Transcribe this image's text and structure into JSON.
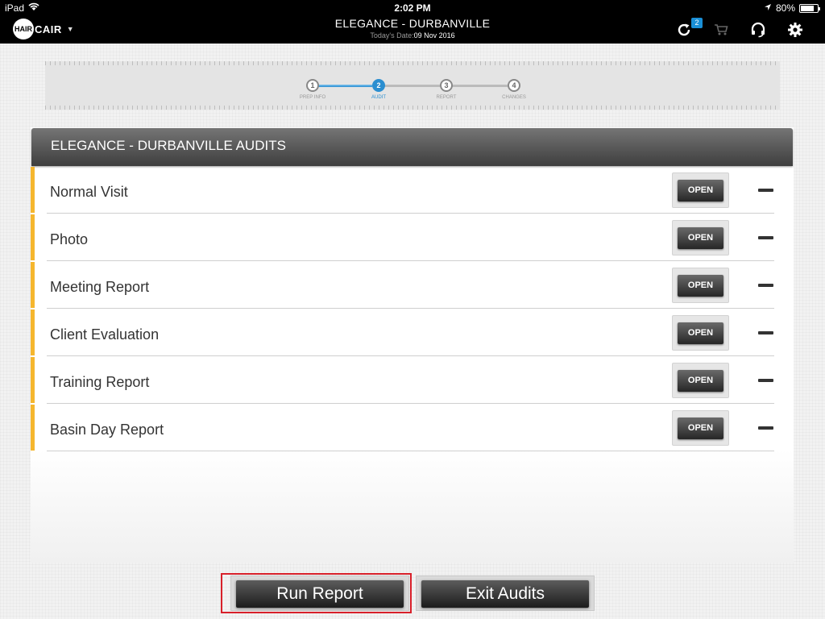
{
  "status_bar": {
    "device": "iPad",
    "time": "2:02 PM",
    "battery": "80%",
    "battery_level": 0.8
  },
  "header": {
    "logo_left": "HAIR",
    "logo_right": "CAIR",
    "store_title": "ELEGANCE - DURBANVILLE",
    "date_label": "Today's Date:",
    "date_value": "09 Nov 2016",
    "sync_badge": "2",
    "icons": [
      "refresh-icon",
      "cart-icon",
      "headset-icon",
      "gear-icon"
    ]
  },
  "stepper": {
    "current_step": 2,
    "steps": [
      {
        "number": "1",
        "label": "PREP INFO"
      },
      {
        "number": "2",
        "label": "AUDIT"
      },
      {
        "number": "3",
        "label": "REPORT"
      },
      {
        "number": "4",
        "label": "CHANGES"
      }
    ]
  },
  "panel": {
    "title": "ELEGANCE - DURBANVILLE AUDITS",
    "open_label": "OPEN",
    "accent_color": "#f5b62e",
    "audits": [
      {
        "name": "Normal Visit"
      },
      {
        "name": "Photo"
      },
      {
        "name": "Meeting Report"
      },
      {
        "name": "Client Evaluation"
      },
      {
        "name": "Training Report"
      },
      {
        "name": "Basin Day Report"
      }
    ]
  },
  "actions": {
    "run_report": "Run Report",
    "exit_audits": "Exit Audits",
    "highlight_color": "#d8202a"
  }
}
